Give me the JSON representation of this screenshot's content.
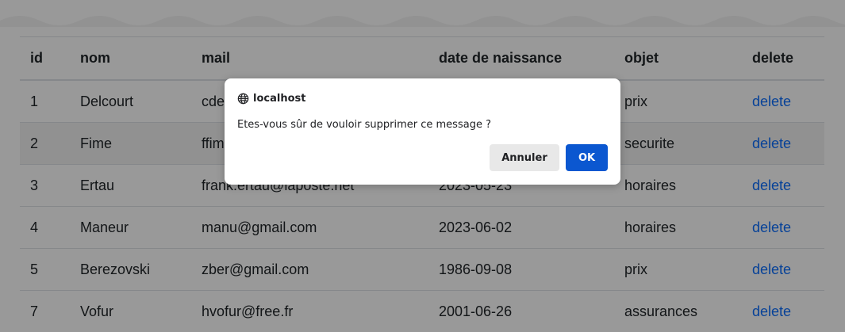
{
  "table": {
    "headers": {
      "id": "id",
      "nom": "nom",
      "mail": "mail",
      "date": "date de naissance",
      "objet": "objet",
      "delete": "delete"
    },
    "rows": [
      {
        "id": "1",
        "nom": "Delcourt",
        "mail": "cde",
        "date": "",
        "objet": "prix",
        "delete": "delete"
      },
      {
        "id": "2",
        "nom": "Fime",
        "mail": "ffim",
        "date": "",
        "objet": "securite",
        "delete": "delete"
      },
      {
        "id": "3",
        "nom": "Ertau",
        "mail": "frank.ertau@laposte.net",
        "date": "2023-05-23",
        "objet": "horaires",
        "delete": "delete"
      },
      {
        "id": "4",
        "nom": "Maneur",
        "mail": "manu@gmail.com",
        "date": "2023-06-02",
        "objet": "horaires",
        "delete": "delete"
      },
      {
        "id": "5",
        "nom": "Berezovski",
        "mail": "zber@gmail.com",
        "date": "1986-09-08",
        "objet": "prix",
        "delete": "delete"
      },
      {
        "id": "7",
        "nom": "Vofur",
        "mail": "hvofur@free.fr",
        "date": "2001-06-26",
        "objet": "assurances",
        "delete": "delete"
      }
    ]
  },
  "dialog": {
    "title": "localhost",
    "message": "Etes-vous sûr de vouloir supprimer ce message ?",
    "cancel_label": "Annuler",
    "ok_label": "OK",
    "icon": "globe-icon"
  },
  "colors": {
    "link": "#0d6efd",
    "ok_button": "#0b57d0",
    "overlay": "rgba(0,0,0,0.40)"
  }
}
